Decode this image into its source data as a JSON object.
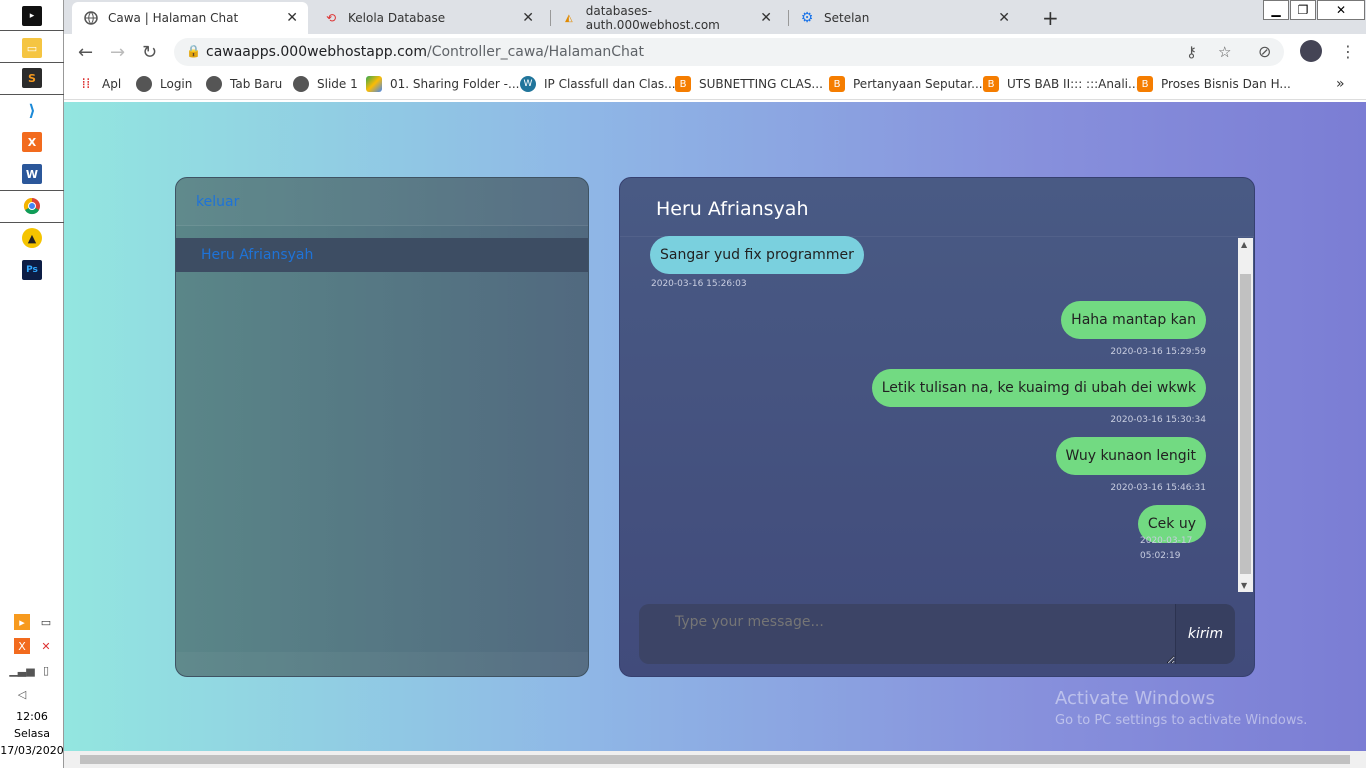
{
  "browser": {
    "tabs": [
      {
        "label": "Cawa | Halaman Chat",
        "favicon": "globe-icon",
        "active": true
      },
      {
        "label": "Kelola Database",
        "favicon": "db-icon",
        "active": false
      },
      {
        "label": "databases-auth.000webhost.com",
        "favicon": "pma-icon",
        "active": false
      },
      {
        "label": "Setelan",
        "favicon": "gear-icon",
        "active": false
      }
    ],
    "url_host": "cawaapps.000webhostapp.com",
    "url_path": "/Controller_cawa/HalamanChat",
    "bookmarks": [
      "Apl",
      "Login",
      "Tab Baru",
      "Slide 1",
      "01. Sharing Folder -...",
      "IP Classfull dan Clas...",
      "SUBNETTING CLAS...",
      "Pertanyaan Seputar...",
      "UTS BAB II::: :::Anali...",
      "Proses Bisnis Dan H..."
    ]
  },
  "sidebar": {
    "logout_label": "keluar",
    "contacts": [
      "Heru Afriansyah"
    ]
  },
  "chat": {
    "title": "Heru Afriansyah",
    "messages": [
      {
        "text": "Sangar yud fix programmer",
        "time": "2020-03-16 15:26:03",
        "direction": "in"
      },
      {
        "text": "Haha mantap kan",
        "time": "2020-03-16 15:29:59",
        "direction": "out"
      },
      {
        "text": "Letik tulisan na, ke kuaimg di ubah dei wkwk",
        "time": "2020-03-16 15:30:34",
        "direction": "out"
      },
      {
        "text": "Wuy kunaon lengit",
        "time": "2020-03-16 15:46:31",
        "direction": "out"
      },
      {
        "text": "Cek uy",
        "time_line1": "2020-03-17",
        "time_line2": "05:02:19",
        "direction": "out"
      }
    ],
    "input_placeholder": "Type your message...",
    "send_label": "kirim"
  },
  "watermark": {
    "line1": "Activate Windows",
    "line2": "Go to PC settings to activate Windows."
  },
  "taskbar": {
    "time": "12:06",
    "day": "Selasa",
    "date": "17/03/2020"
  }
}
